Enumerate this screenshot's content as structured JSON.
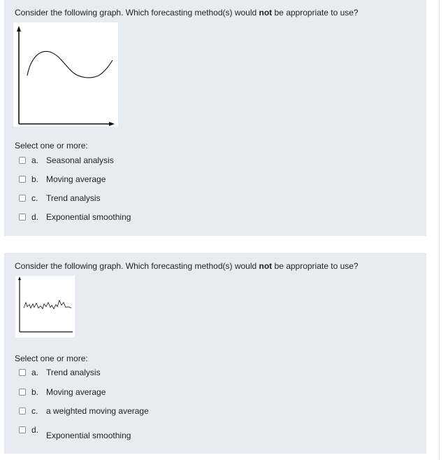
{
  "questions": [
    {
      "prompt_before": "Consider the following graph. Which forecasting method(s) would ",
      "prompt_bold": "not",
      "prompt_after": " be appropriate to use?",
      "graph_icon": "smooth-wave-graph",
      "select_label": "Select one or more:",
      "options": [
        {
          "letter": "a.",
          "text": "Seasonal analysis"
        },
        {
          "letter": "b.",
          "text": "Moving average"
        },
        {
          "letter": "c.",
          "text": "Trend analysis"
        },
        {
          "letter": "d.",
          "text": "Exponential smoothing"
        }
      ]
    },
    {
      "prompt_before": "Consider the following graph. Which forecasting method(s) would ",
      "prompt_bold": "not",
      "prompt_after": " be appropriate to use?",
      "graph_icon": "noisy-fluctuation-graph",
      "select_label": "Select one or more:",
      "options": [
        {
          "letter": "a.",
          "text": "Trend analysis"
        },
        {
          "letter": "b.",
          "text": "Moving average"
        },
        {
          "letter": "c.",
          "text": "a weighted moving average"
        },
        {
          "letter": "d.",
          "text": "Exponential smoothing"
        }
      ]
    }
  ],
  "colors": {
    "question_bg": "#e8ebf1",
    "text": "#1d2125",
    "checkbox_border": "#8a8f98"
  }
}
